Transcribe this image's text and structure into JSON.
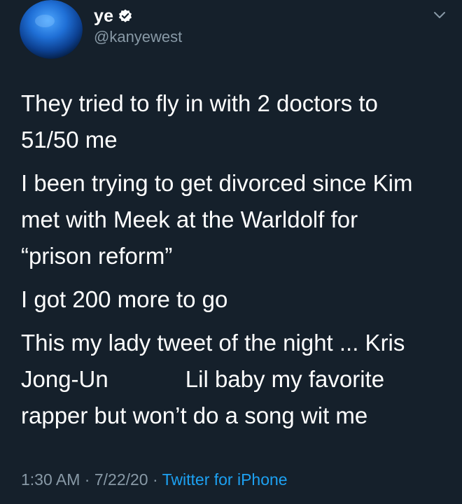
{
  "tweet": {
    "display_name": "ye",
    "handle": "@kanyewest",
    "verified": true,
    "paragraphs": [
      "They tried to fly in with 2 doctors to\n51/50 me",
      "I been trying to get divorced since Kim\nmet with Meek at the Warldolf for\n“prison reform”",
      "I got 200 more to go",
      "This my lady tweet of the night ... Kris\nJong-Un            Lil baby my favorite\nrapper but won’t do a song wit me"
    ],
    "time": "1:30 AM",
    "separator": " · ",
    "date": "7/22/20",
    "source": "Twitter for iPhone"
  },
  "icons": {
    "avatar": "blue-globe-avatar",
    "verified": "verified-badge-icon",
    "menu": "chevron-down-icon"
  },
  "colors": {
    "background": "#15202b",
    "secondary_text": "#8899a6",
    "link": "#1da1f2"
  }
}
